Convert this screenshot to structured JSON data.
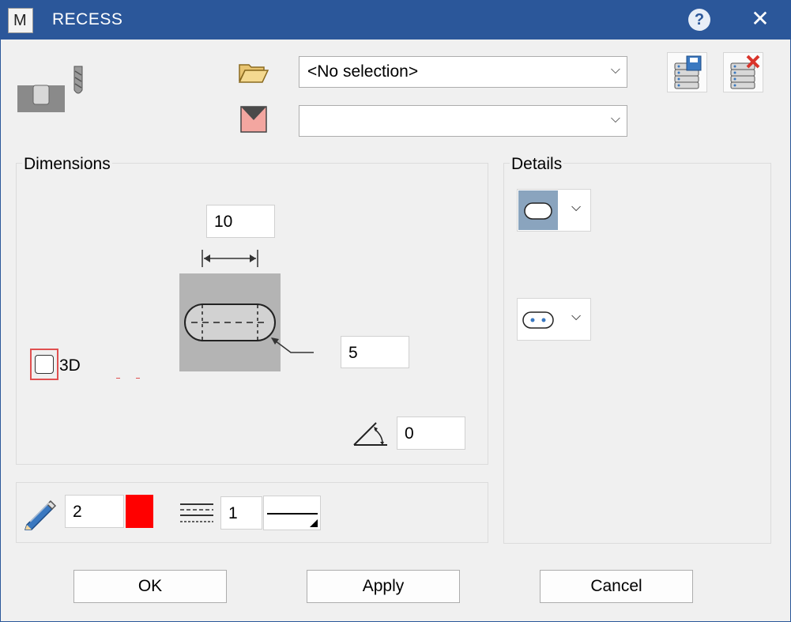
{
  "window": {
    "title": "RECESS",
    "app_icon_letter": "M",
    "help_glyph": "?",
    "close_glyph": "✕"
  },
  "selectors": {
    "folder_combo": {
      "value": "<No selection>"
    },
    "material_combo": {
      "value": ""
    }
  },
  "dimensions": {
    "label": "Dimensions",
    "width_value": "10",
    "radius_value": "5",
    "angle_value": "0",
    "checkbox_3d": {
      "label": "3D",
      "checked": false
    }
  },
  "pen": {
    "width_value": "2",
    "color": "#ff0000",
    "line_value": "1"
  },
  "details": {
    "label": "Details"
  },
  "buttons": {
    "ok": "OK",
    "apply": "Apply",
    "cancel": "Cancel"
  },
  "colors": {
    "titlebar": "#2b579a",
    "highlight": "#e05050"
  }
}
